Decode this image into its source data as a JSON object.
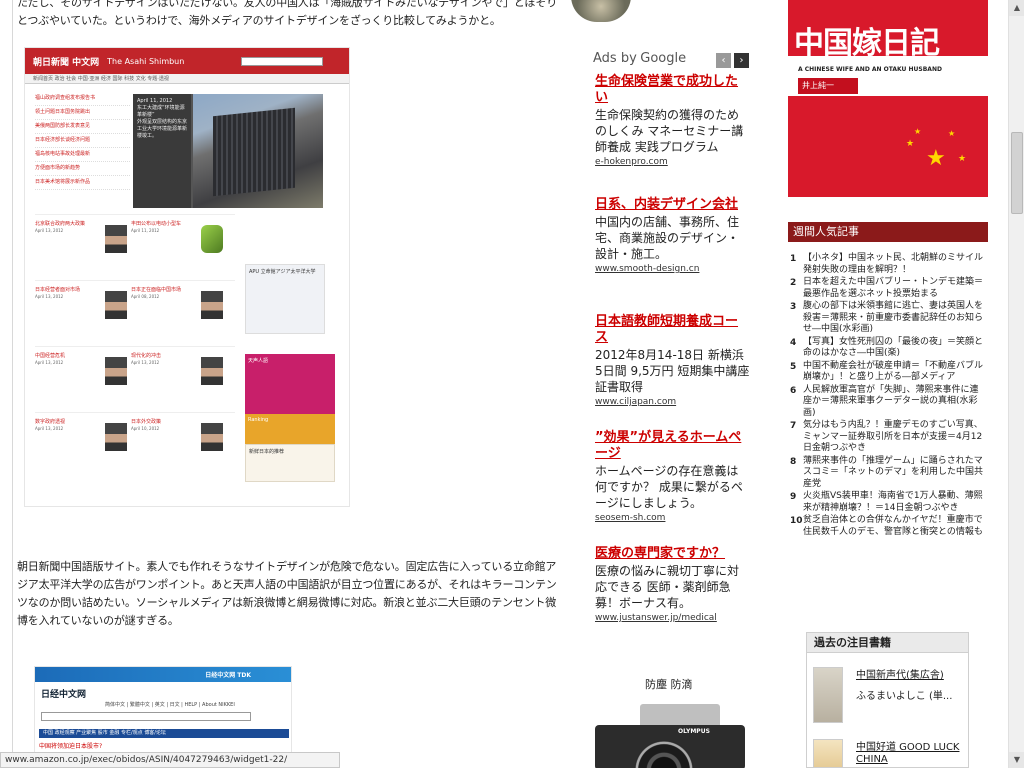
{
  "article": {
    "intro_text": "ただし、そのサイトデザインはいただけない。友人の中国人は「海賊版サイトみたいなデザインやで」とぼそりとつぶやいていた。というわけで、海外メディアのサイトデザインをざっくり比較してみようかと。",
    "asahi_paragraph": "朝日新聞中国語版サイト。素人でも作れそうなサイトデザインが危険で危ない。固定広告に入っている立命館アジア太平洋大学の広告がワンポイント。あと天声人語の中国語訳が目立つ位置にあるが、それはキラーコンテンツなのか問い詰めたい。ソーシャルメディアは新浪微博と網易微博に対応。新浪と並ぶ二大巨頭のテンセント微博を入れていないのが謎すぎる。"
  },
  "asahi_thumb": {
    "logo": "朝日新聞 中文网",
    "logo_en": "The Asahi Shimbun",
    "nav": "新闻首页  政治  社会  中国·亚洲  经济  国际  科技  文化  专题·透视",
    "list": [
      "福山政府调查组发布报告书",
      "领土问题日本国务院跳出",
      "美俄两国防部长发表意见",
      "日本经济部长谈经济问题",
      "福岛核电站事故处理最新",
      "方便面市场的新趋势",
      "日本美术馆将展示新作品"
    ],
    "hero_date": "April 11, 2012",
    "hero_title": "东工大建成“环境能源革新楼”",
    "hero_desc": "外观呈双层结构的东京工业大学环境能源革新楼竣工。",
    "cells": [
      {
        "title": "北京联合政府两大政策",
        "date": "April 13, 2012"
      },
      {
        "title": "丰田公布以电动小型车",
        "date": "April 11, 2012"
      },
      {
        "title": "日本经营者面对市场",
        "date": "April 13, 2012"
      },
      {
        "title": "日本正在面临中国市场",
        "date": "April 08, 2012"
      },
      {
        "title": "中国经营危机",
        "date": "April 13, 2012"
      },
      {
        "title": "现代化的冲击",
        "date": "April 13, 2012"
      },
      {
        "title": "数字政府透视",
        "date": "April 13, 2012"
      },
      {
        "title": "日本外交政策",
        "date": "April 10, 2012"
      }
    ],
    "ad_apu": "APU 立命館アジア太平洋大学",
    "ad_tensei": "天声人語",
    "ad_ranking": "Ranking",
    "ad_book": "新鲜日本的推荐"
  },
  "nikkei_thumb": {
    "banner": "日经中文网 TDK",
    "logo": "日经中文网",
    "nav": "简体中文 | 繁體中文 | 英文 | 日文 | HELP | About NIKKEI",
    "bar": "中国  政经观察  产业聚焦  股市  金融  专栏/观点  博客/论坛",
    "headline": "中国将领加迫日本股市?"
  },
  "ads": {
    "ads_by": "Ads by",
    "google": "Google",
    "prev": "‹",
    "next": "›",
    "items": [
      {
        "title": "生命保険営業で成功したい",
        "body": "生命保険契約の獲得のためのしくみ マネーセミナー講師養成 実践プログラム",
        "url": "e-hokenpro.com"
      },
      {
        "title": "日系、内装デザイン会社",
        "body": "中国内の店舗、事務所、住宅、商業施設のデザイン・設計・施工。",
        "url": "www.smooth-design.cn"
      },
      {
        "title": "日本語教師短期養成コース",
        "body": "2012年8月14-18日 新横浜 5日間 9,5万円 短期集中講座 証書取得",
        "url": "www.ciljapan.com"
      },
      {
        "title": "”効果”が見えるホームページ",
        "body": "ホームページの存在意義は何ですか？ 成果に繋がるページにしましょう。",
        "url": "seosem-sh.com"
      },
      {
        "title": "医療の専門家ですか？",
        "body": "医療の悩みに親切丁寧に対応できる 医師・薬剤師急募！ボーナス有。",
        "url": "www.justanswer.jp/medical"
      }
    ],
    "camera_label": "防塵 防滴",
    "camera_brand": "OLYMPUS"
  },
  "sidebar": {
    "book_title": "中国嫁日記",
    "book_sub": "A CHINESE WIFE AND AN OTAKU HUSBAND",
    "book_author": "井上純一",
    "ranking_title": "週間人気記事",
    "ranking": [
      {
        "num": "1",
        "text": "【小ネタ】中国ネット民、北朝鮮のミサイル発射失敗の理由を解明？！"
      },
      {
        "num": "2",
        "text": "日本を超えた中国バブリー・トンデモ建築＝最悪作品を選ぶネット投票始まる"
      },
      {
        "num": "3",
        "text": "腹心の部下は米領事館に逃亡、妻は英国人を殺害＝薄熙来・前重慶市委書記辞任のお知らせ―中国(水彩画)"
      },
      {
        "num": "4",
        "text": "【写真】女性死刑囚の「最後の夜」＝笑顔と命のはかなさ―中国(楽)"
      },
      {
        "num": "5",
        "text": "中国不動産会社が破産申請＝「不動産バブル崩壊か」！と盛り上がる―部メディア"
      },
      {
        "num": "6",
        "text": "人民解放軍高官が「失脚」、薄熙来事件に連座か＝薄熙来軍事クーデター説の真相(水彩画)"
      },
      {
        "num": "7",
        "text": "気分はもう内乱？！重慶デモのすごい写真、ミャンマー証券取引所を日本が支援＝4月12日金朝つぶやき"
      },
      {
        "num": "8",
        "text": "薄熙来事件の「推理ゲーム」に踊らされたマスコミ＝「ネットのデマ」を利用した中国共産党"
      },
      {
        "num": "9",
        "text": "火炎瓶VS装甲車！海南省で1万人暴動、薄熙来が精神崩壊？！＝14日金朝つぶやき"
      },
      {
        "num": "10",
        "text": "贫乏自治体との合併なんかイヤだ！重慶市で住民数千人のデモ、警官隊と衝突との情報も"
      }
    ],
    "past_title": "過去の注目書籍",
    "past_items": [
      {
        "title": "中国新声代(集広舎)",
        "author": "ふるまいよしこ (単..."
      },
      {
        "title": "中国好道 GOOD LUCK CHINA",
        "author": ""
      }
    ]
  },
  "status_url": "www.amazon.co.jp/exec/obidos/ASIN/4047279463/widget1-22/"
}
